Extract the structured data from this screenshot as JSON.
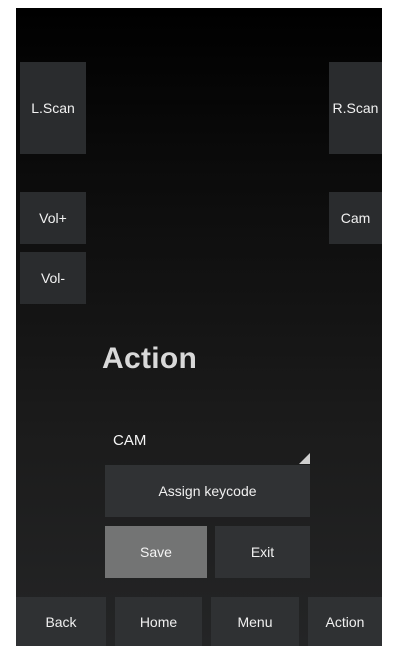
{
  "keys": {
    "left_scan": "L.Scan",
    "right_scan": "R.Scan",
    "vol_up": "Vol+",
    "vol_down": "Vol-",
    "cam": "Cam"
  },
  "dialog": {
    "title": "Action",
    "keycode_select": {
      "value": "CAM"
    },
    "assign_label": "Assign keycode",
    "save_label": "Save",
    "exit_label": "Exit"
  },
  "navbar": {
    "back": "Back",
    "home": "Home",
    "menu": "Menu",
    "action": "Action"
  }
}
